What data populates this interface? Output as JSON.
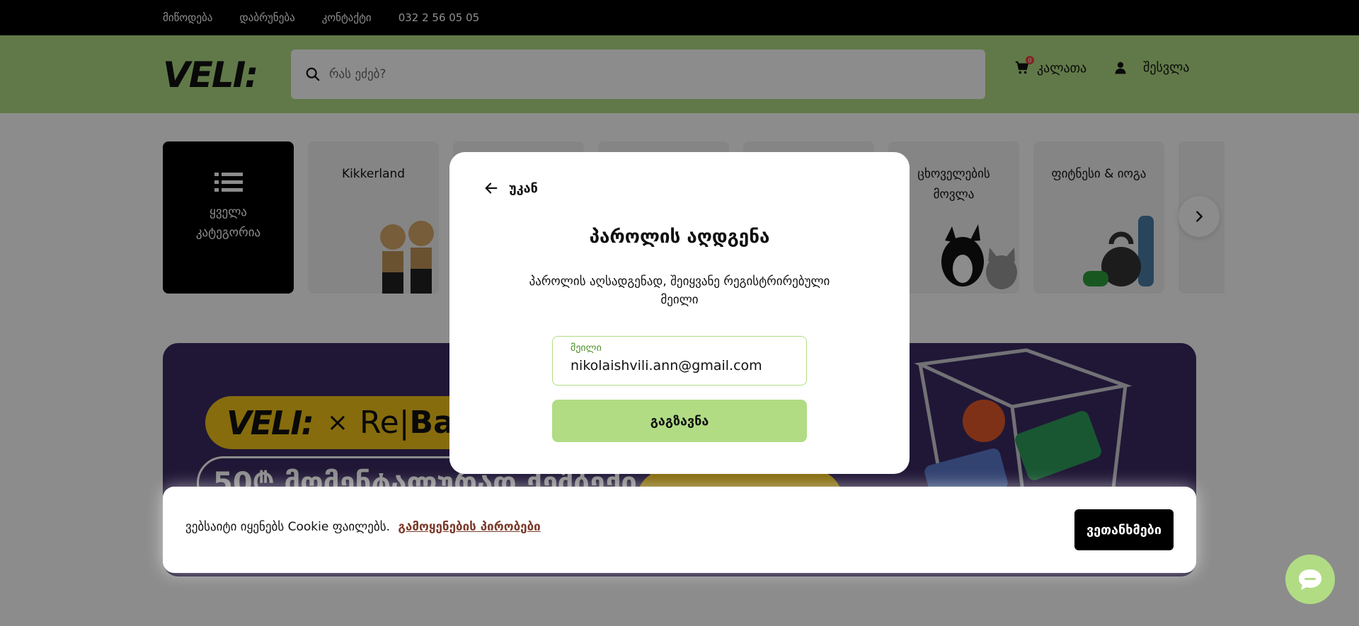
{
  "topbar": {
    "links": [
      "მიწოდება",
      "დაბრუნება",
      "კონტაქტი",
      "032 2 56 05 05"
    ]
  },
  "header": {
    "logo_text": "VELI:",
    "search_placeholder": "რას ეძებ?",
    "cart_label": "კალათა",
    "cart_count": "0",
    "login_label": "შესვლა"
  },
  "categories": [
    {
      "label": "ყველა კატეგორია"
    },
    {
      "label": "Kikkerland"
    },
    {
      "label": ""
    },
    {
      "label": ""
    },
    {
      "label": ""
    },
    {
      "label": "ცხოველების მოვლა"
    },
    {
      "label": "ფიტნესი & იოგა"
    }
  ],
  "banner": {
    "logo": "VELI:",
    "times": "×",
    "partner_1": "Re|",
    "partner_2": "Ba",
    "line2": "50₾ მომენტალურად ქეშბექი"
  },
  "modal": {
    "back_label": "უკან",
    "title": "პაროლის აღდგენა",
    "description": "პაროლის აღსადგენად, შეიყვანე რეგისტრირებული მეილი",
    "email_label": "მეილი",
    "email_value": "nikolaishvili.ann@gmail.com",
    "send_label": "გაგზავნა"
  },
  "cookie": {
    "text": "ვებსაიტი იყენებს Cookie ფაილებს.",
    "link": "გამოყენების პირობები",
    "accept": "ვეთანხმები"
  },
  "colors": {
    "accent": "#b1dc84",
    "dark": "#000000",
    "banner": "#3b2a63",
    "link": "#7b3a2a"
  }
}
